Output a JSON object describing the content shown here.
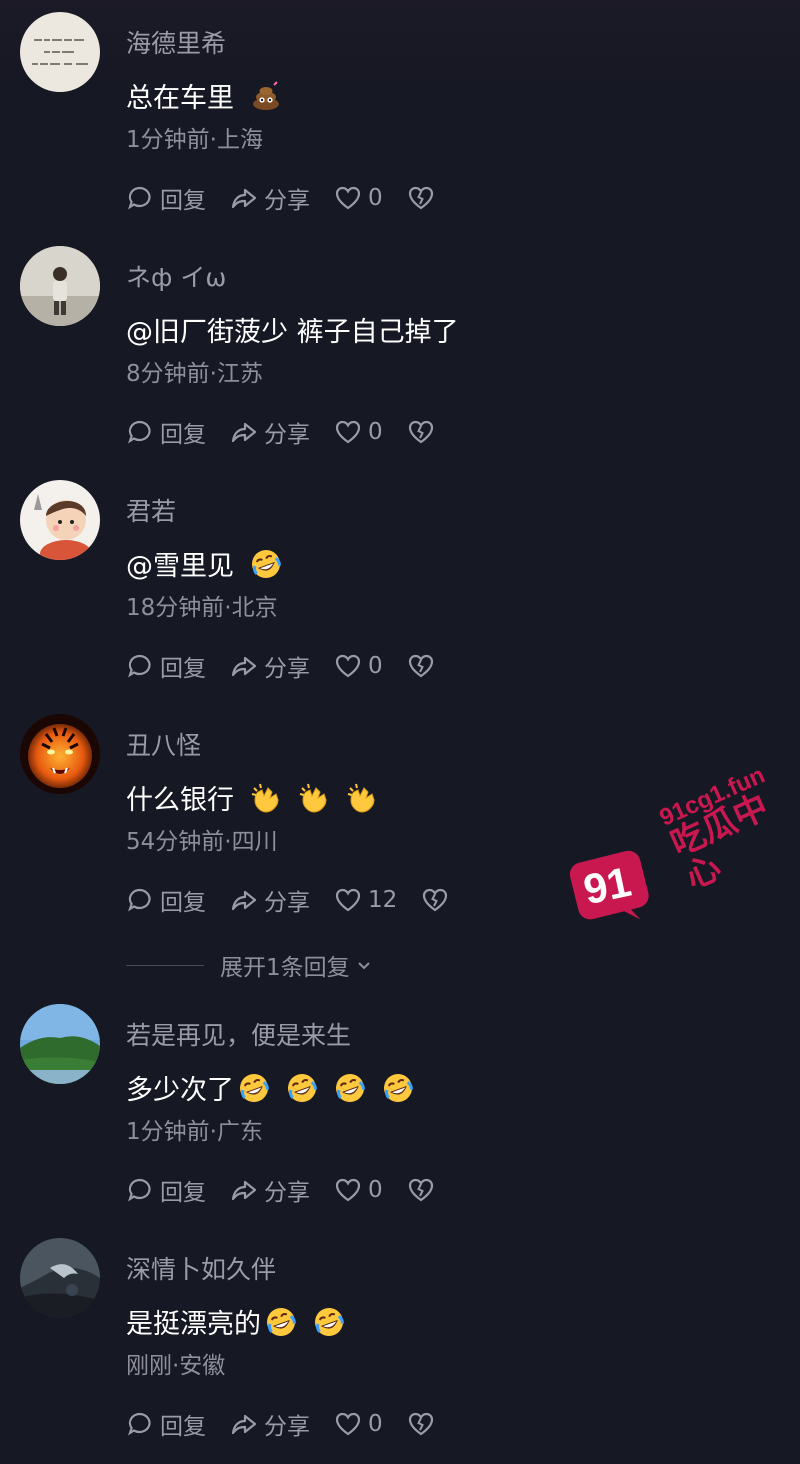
{
  "comments": [
    {
      "username": "海德里希",
      "text": "总在车里",
      "emojis": [
        "poop-emoji"
      ],
      "meta": "1分钟前·上海",
      "reply_label": "回复",
      "share_label": "分享",
      "likes": "0",
      "avatar": "handwriting-avatar"
    },
    {
      "username": "ネф イω",
      "text": "@旧厂街菠少  裤子自己掉了",
      "emojis": [],
      "meta": "8分钟前·江苏",
      "reply_label": "回复",
      "share_label": "分享",
      "likes": "0",
      "avatar": "person-photo-avatar"
    },
    {
      "username": "君若",
      "text": "@雪里见",
      "emojis": [
        "rofl-emoji"
      ],
      "meta": "18分钟前·北京",
      "reply_label": "回复",
      "share_label": "分享",
      "likes": "0",
      "avatar": "cartoon-boy-avatar"
    },
    {
      "username": "丑八怪",
      "text": "什么银行",
      "emojis": [
        "clap-emoji",
        "clap-emoji",
        "clap-emoji"
      ],
      "meta": "54分钟前·四川",
      "reply_label": "回复",
      "share_label": "分享",
      "likes": "12",
      "avatar": "tiger-avatar"
    },
    {
      "username": "若是再见，便是来生",
      "text": "多少次了",
      "emojis": [
        "rofl-emoji",
        "rofl-emoji",
        "rofl-emoji",
        "rofl-emoji"
      ],
      "meta": "1分钟前·广东",
      "reply_label": "回复",
      "share_label": "分享",
      "likes": "0",
      "avatar": "landscape-avatar"
    },
    {
      "username": "深情卜如久伴",
      "text": "是挺漂亮的",
      "emojis": [
        "rofl-emoji",
        "rofl-emoji"
      ],
      "meta": "刚刚·安徽",
      "reply_label": "回复",
      "share_label": "分享",
      "likes": "0",
      "avatar": "dark-photo-avatar"
    }
  ],
  "expand_replies": "展开1条回复",
  "watermark": {
    "number": "91",
    "domain": "91cg1.fun",
    "name": "吃瓜中心",
    "color": "#c8184f"
  },
  "colors": {
    "background": "#161824",
    "primary_text": "#ffffff",
    "secondary_text": "#9a9ba6"
  }
}
